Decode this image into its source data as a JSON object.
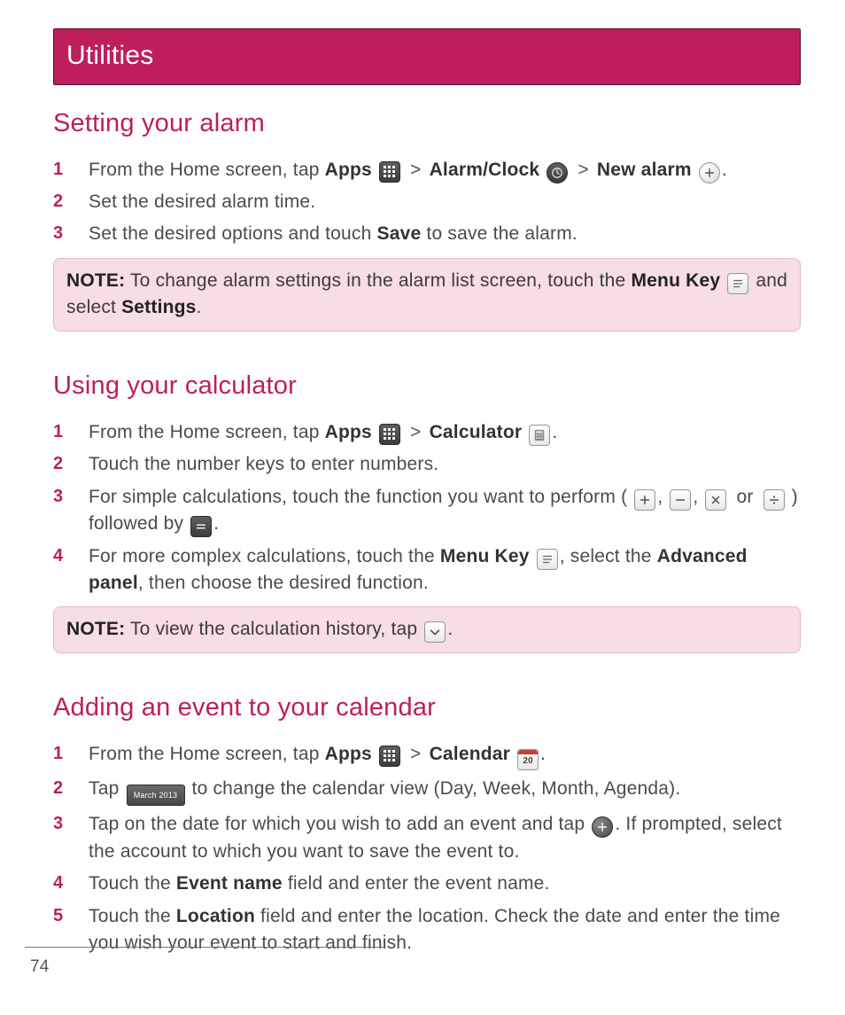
{
  "banner": {
    "title": "Utilities"
  },
  "sections": {
    "alarm": {
      "heading": "Setting your alarm",
      "s1a": "From the Home screen, tap ",
      "apps": "Apps",
      "gt": ">",
      "alarmclock": "Alarm/Clock",
      "newalarm": "New alarm",
      "dot": ".",
      "s2": "Set the desired alarm time.",
      "s3a": "Set the desired options and touch ",
      "save": "Save",
      "s3b": " to save the alarm.",
      "note_a": "NOTE:",
      "note_b": " To change alarm settings in the alarm list screen, touch the ",
      "menukey": "Menu Key",
      "note_c": " and select ",
      "settings": "Settings",
      "note_d": "."
    },
    "calc": {
      "heading": "Using your calculator",
      "s1a": "From the Home screen, tap ",
      "apps": "Apps",
      "gt": ">",
      "calculator": "Calculator",
      "dot": ".",
      "s2": "Touch the number keys to enter numbers.",
      "s3a": "For simple calculations, touch the function you want to perform ( ",
      "comma": ", ",
      "or": " or ",
      "s3b": " ) followed by ",
      "s4a": "For more complex calculations, touch the ",
      "menukey": "Menu Key",
      "s4b": ", select the ",
      "adv": "Advanced panel",
      "s4c": ", then choose the desired function.",
      "note_a": "NOTE:",
      "note_b": " To view the calculation history, tap "
    },
    "cal": {
      "heading": "Adding an event to your calendar",
      "s1a": "From the Home screen, tap ",
      "apps": "Apps",
      "gt": ">",
      "calendar": "Calendar",
      "day": "20",
      "dot": ".",
      "s2a": "Tap ",
      "month": "March 2013",
      "s2b": " to change the calendar view (Day, Week, Month, Agenda).",
      "s3a": "Tap on the date for which you wish to add an event and tap ",
      "s3b": ". If prompted, select the account to which you want to save the event to.",
      "s4a": "Touch the ",
      "evname": "Event name",
      "s4b": " field and enter the event name.",
      "s5a": "Touch the ",
      "loc": "Location",
      "s5b": " field and enter the location. Check the date and enter the time you wish your event to start and finish."
    }
  },
  "nums": {
    "1": "1",
    "2": "2",
    "3": "3",
    "4": "4",
    "5": "5"
  },
  "page": "74"
}
